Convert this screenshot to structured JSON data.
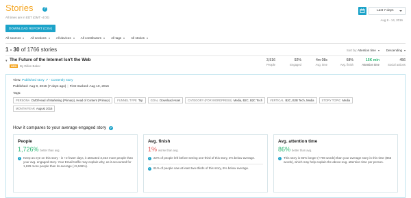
{
  "header": {
    "title": "Stories",
    "help_glyph": "?",
    "subtitle": "All times are in EDT (GMT -4:00)",
    "download_label": "DOWNLOAD REPORT (CSV)",
    "date_select": "Last 7 days",
    "date_range": "Aug 8 - 14, 2016",
    "calendar_icon": "calendar-icon"
  },
  "filters": [
    "All sources",
    "All sections",
    "All devices",
    "All contributors",
    "All tags",
    "All stories"
  ],
  "list": {
    "count_range": "1 - 30",
    "count_rest": "of 1766 stories",
    "sort_by_label": "Sort by:",
    "sort_by_value": "Attention time",
    "order_value": "Descending"
  },
  "story": {
    "title": "The Future of the Internet Isn't the Web",
    "badge": "NEW",
    "byline": "By Dillon Baker",
    "metrics": [
      {
        "value": "3,516",
        "label": "People",
        "highlight": false
      },
      {
        "value": "92%",
        "label": "Engaged",
        "highlight": false
      },
      {
        "value": "4m 08s",
        "label": "Avg. time",
        "highlight": false
      },
      {
        "value": "68%",
        "label": "Avg. finish",
        "highlight": false
      },
      {
        "value": "15K min",
        "label": "Attention time",
        "highlight": true
      },
      {
        "value": "456",
        "label": "Social actions",
        "highlight": false
      }
    ]
  },
  "detail": {
    "view_label": "View:",
    "view_published": "Published story",
    "view_content": "Contently story",
    "published": "Published: Aug 9, 2016 (7 days ago)",
    "first_tracked": "First tracked: Aug 10, 2016",
    "tags_label": "Tags:",
    "tags": [
      {
        "key": "PERSONA",
        "value": "CMO/Head of Marketing (Primary), Head of Content (Primary)"
      },
      {
        "key": "FUNNEL TYPE",
        "value": "Top"
      },
      {
        "key": "GOAL",
        "value": "Download Asset"
      },
      {
        "key": "CATEGORY (FOR WORDPRESS)",
        "value": "Media, B2C, B2C Tech"
      },
      {
        "key": "VERTICAL",
        "value": "B2C, B2B Tech, Media"
      },
      {
        "key": "STORY TOPIC",
        "value": "Media"
      },
      {
        "key": "MONTH/YEAR",
        "value": "August 2016"
      }
    ],
    "compare_title": "How it compares to your average engaged story"
  },
  "cards": {
    "people": {
      "title": "People",
      "value": "1,726%",
      "qualifier": "better than avg.",
      "bullet1": "Keep an eye on this story - in +2 fewer days, it attracted 3,323 more people than your avg. engaged story. Your Email traffic may explain why, as it accounted for 1,629 more people than its average (+5,946%)."
    },
    "finish": {
      "title": "Avg. finish",
      "value": "1%",
      "qualifier": "worse than avg.",
      "bullet1": "22% of people left before seeing one-third of this story, 3% below average.",
      "bullet2": "61% of people saw at least two-thirds of this story, 6% below average."
    },
    "attention": {
      "title": "Avg. attention time",
      "value": "86%",
      "qualifier": "better than avg.",
      "bullet1": "This story is 82% longer (+708 words) than your average story in this time (863 words), which may help explain the above-avg. attention time per person."
    }
  },
  "colors": {
    "accent": "#1ca3c9",
    "title_orange": "#f5a623",
    "positive": "#2bb673",
    "negative": "#e25555"
  }
}
